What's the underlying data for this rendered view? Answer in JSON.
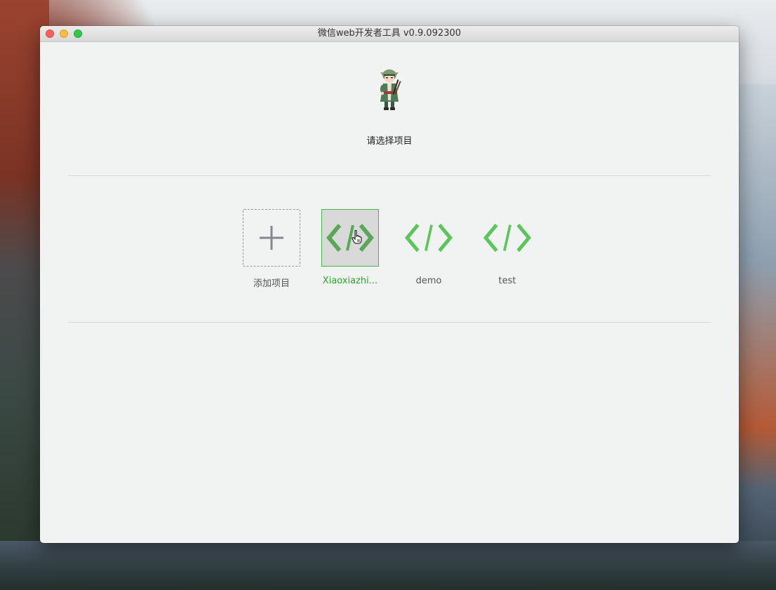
{
  "window": {
    "title": "微信web开发者工具 v0.9.092300"
  },
  "main": {
    "prompt": "请选择项目",
    "add_project_label": "添加项目",
    "projects": [
      {
        "name": "Xiaoxiazhi...",
        "selected": true
      },
      {
        "name": "demo",
        "selected": false
      },
      {
        "name": "test",
        "selected": false
      }
    ]
  },
  "colors": {
    "accent_green": "#4bb54b",
    "selected_text": "#2aa52a",
    "window_bg": "#f1f2f2"
  },
  "icons": {
    "add": "plus-icon",
    "project": "code-brackets-icon",
    "cursor": "hand-pointer-icon"
  }
}
